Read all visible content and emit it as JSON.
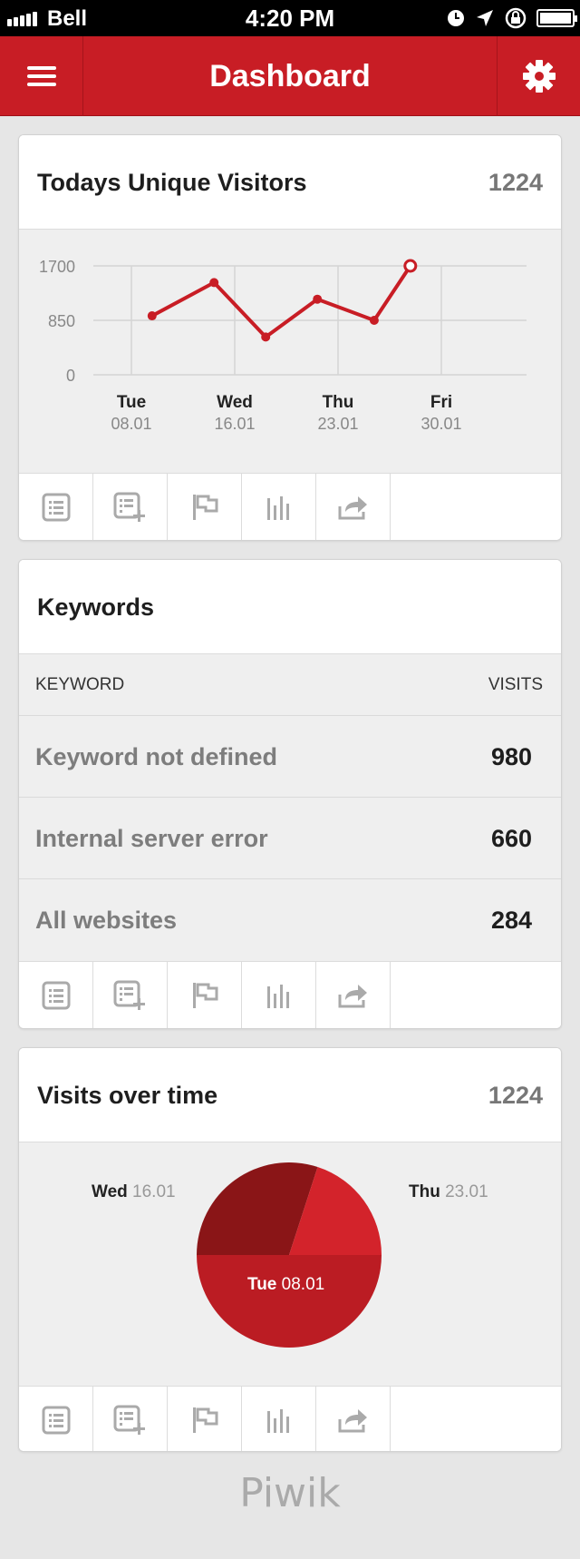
{
  "status_bar": {
    "carrier": "Bell",
    "time": "4:20 PM"
  },
  "navbar": {
    "title": "Dashboard"
  },
  "visitors_card": {
    "title": "Todays Unique Visitors",
    "value": "1224"
  },
  "chart_data": {
    "type": "line",
    "title": "",
    "xlabel": "",
    "ylabel": "",
    "ylim": [
      0,
      1700
    ],
    "yticks": [
      "1700",
      "850",
      "0"
    ],
    "x_ticks": [
      {
        "day": "Tue",
        "date": "08.01"
      },
      {
        "day": "Wed",
        "date": "16.01"
      },
      {
        "day": "Thu",
        "date": "23.01"
      },
      {
        "day": "Fri",
        "date": "30.01"
      }
    ],
    "series": [
      {
        "x": [
          0.2,
          0.8,
          1.3,
          1.8,
          2.35,
          2.7
        ],
        "values": [
          920,
          1440,
          590,
          1180,
          850,
          1700
        ]
      }
    ],
    "grid": true,
    "color": "#c81d25"
  },
  "keywords_card": {
    "title": "Keywords",
    "col_keyword": "KEYWORD",
    "col_visits": "VISITS",
    "rows": [
      {
        "keyword": "Keyword not defined",
        "visits": "980"
      },
      {
        "keyword": "Internal server error",
        "visits": "660"
      },
      {
        "keyword": "All websites",
        "visits": "284"
      }
    ]
  },
  "visits_card": {
    "title": "Visits over time",
    "value": "1224",
    "pie": {
      "type": "pie",
      "slices": [
        {
          "day": "Tue",
          "date": "08.01",
          "value": 50,
          "color": "#bb1c23"
        },
        {
          "day": "Wed",
          "date": "16.01",
          "value": 30,
          "color": "#8a1517"
        },
        {
          "day": "Thu",
          "date": "23.01",
          "value": 20,
          "color": "#d3232b"
        }
      ]
    }
  },
  "toolbar_icons": [
    "table-icon",
    "add-table-icon",
    "flag-icon",
    "bar-chart-icon",
    "share-icon"
  ],
  "footer": {
    "brand": "Piwik"
  },
  "colors": {
    "accent": "#c81d25",
    "background": "#e6e6e6"
  }
}
